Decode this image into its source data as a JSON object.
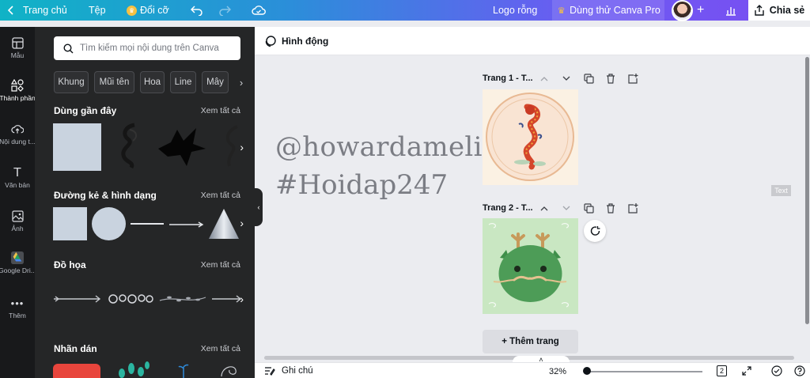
{
  "topbar": {
    "home": "Trang chủ",
    "file": "Tệp",
    "resize": "Đổi cỡ",
    "design_title": "Logo rỗng",
    "try_pro": "Dùng thử Canva Pro",
    "share": "Chia sẻ"
  },
  "rail": {
    "items": [
      {
        "label": "Mẫu",
        "icon": "template-icon"
      },
      {
        "label": "Thành phần",
        "icon": "elements-icon"
      },
      {
        "label": "Nội dung t...",
        "icon": "upload-icon"
      },
      {
        "label": "Văn bản",
        "icon": "text-icon"
      },
      {
        "label": "Ảnh",
        "icon": "photo-icon"
      },
      {
        "label": "Google Dri...",
        "icon": "google-drive-icon"
      },
      {
        "label": "Thêm",
        "icon": "more-icon"
      }
    ]
  },
  "panel": {
    "search_placeholder": "Tìm kiếm mọi nội dung trên Canva",
    "chips": [
      "Khung",
      "Mũi tên",
      "Hoa",
      "Line",
      "Mây"
    ],
    "sections": [
      {
        "title": "Dùng gần đây",
        "see_all": "Xem tất cả"
      },
      {
        "title": "Đường kẻ & hình dạng",
        "see_all": "Xem tất cả"
      },
      {
        "title": "Đồ họa",
        "see_all": "Xem tất cả"
      },
      {
        "title": "Nhãn dán",
        "see_all": "Xem tất cả"
      }
    ]
  },
  "editor": {
    "animate": "Hình động",
    "watermark_line1": "@howardamelia",
    "watermark_line2": "#Hoidap247",
    "pages": [
      {
        "title": "Trang 1 - T..."
      },
      {
        "title": "Trang 2 - T..."
      }
    ],
    "add_page": "+ Thêm trang",
    "text_tag": "Text"
  },
  "bottombar": {
    "notes": "Ghi chú",
    "zoom": "32%",
    "page_count": "2"
  },
  "colors": {
    "topbar_start": "#10b3c6",
    "topbar_end": "#7b4df2",
    "panel_bg": "#252627",
    "rail_bg": "#18191b",
    "canvas_bg": "#ebecf0"
  }
}
